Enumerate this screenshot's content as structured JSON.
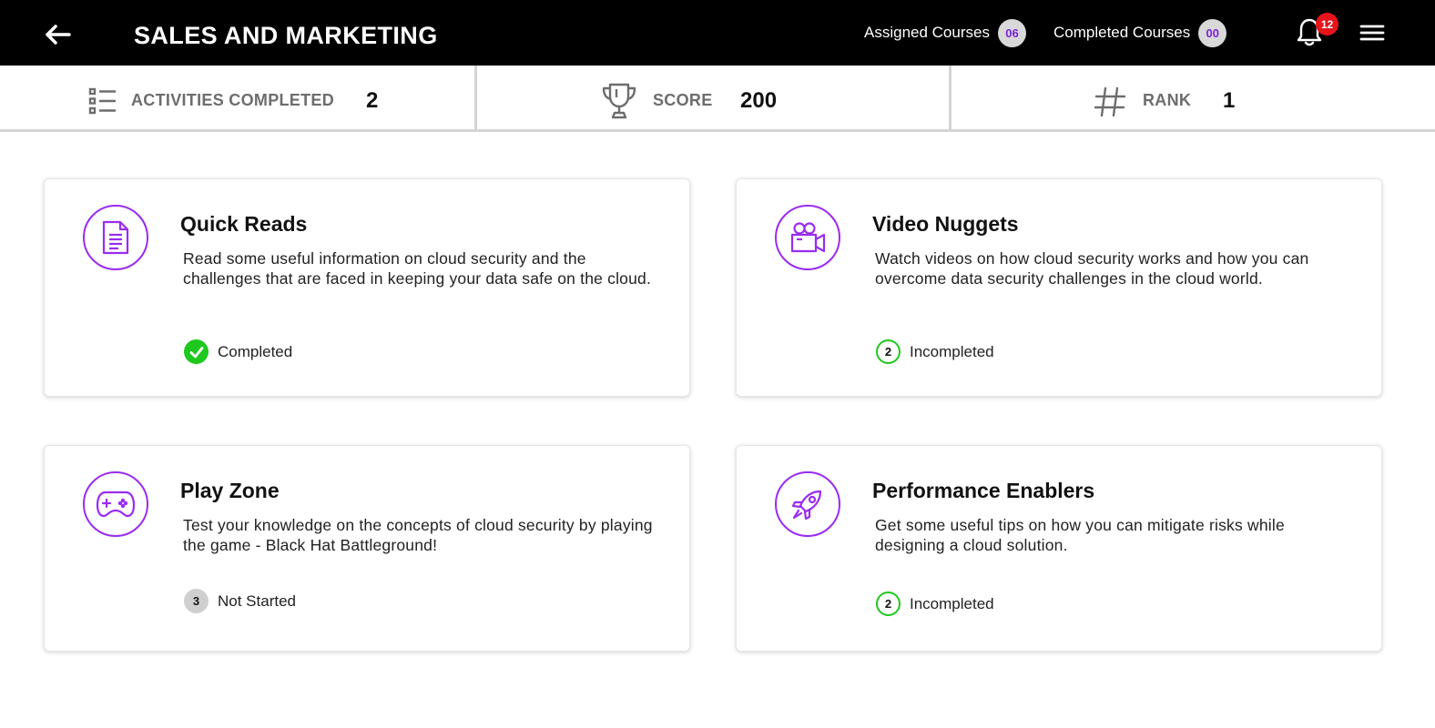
{
  "header": {
    "title": "SALES AND MARKETING",
    "assigned_label": "Assigned Courses",
    "assigned_count": "06",
    "completed_label": "Completed Courses",
    "completed_count": "00",
    "notification_count": "12"
  },
  "stats": {
    "activities_label": "ACTIVITIES COMPLETED",
    "activities_value": "2",
    "score_label": "SCORE",
    "score_value": "200",
    "rank_label": "RANK",
    "rank_value": "1"
  },
  "cards": [
    {
      "title": "Quick Reads",
      "icon": "document-icon",
      "description": "Read some useful information on cloud security and the challenges that are faced in keeping your data safe on the cloud.",
      "status": "Completed",
      "badge": ""
    },
    {
      "title": "Video Nuggets",
      "icon": "video-camera-icon",
      "description": "Watch videos on how cloud security works and how you can overcome data security challenges in the cloud world.",
      "status": "Incompleted",
      "badge": "2"
    },
    {
      "title": "Play Zone",
      "icon": "gamepad-icon",
      "description": "Test your knowledge on the concepts of cloud security by playing the game - Black Hat Battleground!",
      "status": "Not Started",
      "badge": "3"
    },
    {
      "title": "Performance Enablers",
      "icon": "rocket-icon",
      "description": "Get some useful tips on how you can mitigate risks while designing a cloud solution.",
      "status": "Incompleted",
      "badge": "2"
    }
  ],
  "colors": {
    "accent": "#9a2cf0",
    "header_bg": "#000000",
    "success": "#1ec81e",
    "notification": "#e8141c"
  }
}
